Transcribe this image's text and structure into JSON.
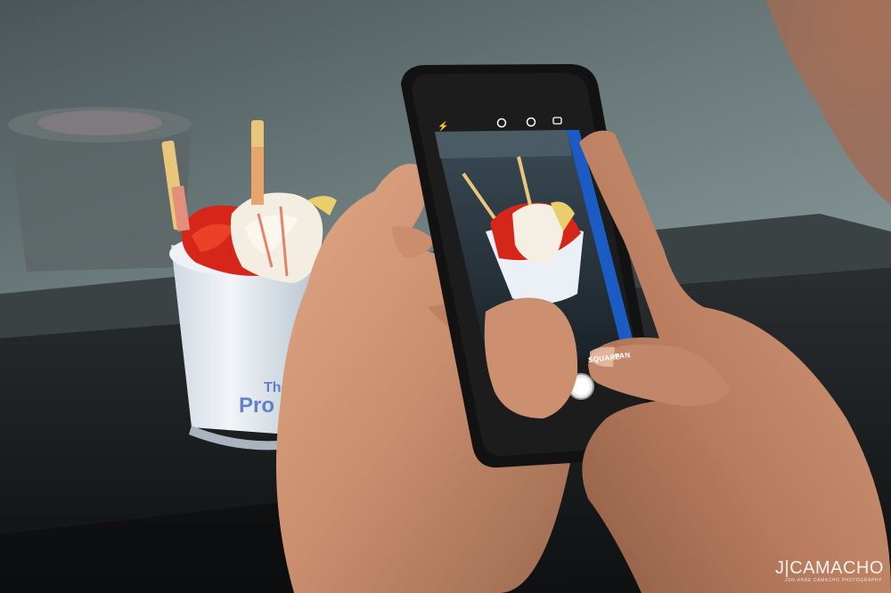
{
  "phone": {
    "camera_modes": [
      "SQUARE",
      "PAN"
    ]
  },
  "cup": {
    "brand_partial_top": "The",
    "brand_partial_bottom": "Pro"
  },
  "watermark": {
    "main": "J|CAMACHO",
    "sub": "JON-ANNE CAMACHO PHOTOGRAPHY"
  },
  "colors": {
    "strawberry_red": "#d6261a",
    "cream": "#f4eee2",
    "cup_white": "#e8eef4",
    "phone_black": "#121212",
    "skin": "#c98e6e"
  }
}
